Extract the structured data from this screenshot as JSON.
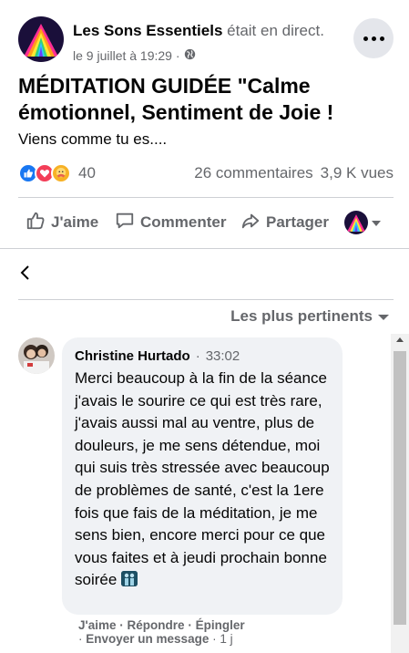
{
  "post": {
    "page_name": "Les Sons Essentiels",
    "live_text": "était en direct.",
    "date": "le 9 juillet à 19:29 ·",
    "audience_icon": "globe-icon",
    "title": "MÉDITATION GUIDÉE \"Calme émotionnel, Sentiment de Joie !",
    "text": "Viens comme tu es....",
    "reaction_count": "40",
    "comments_count": "26 commentaires",
    "views_count": "3,9 K vues"
  },
  "actions": {
    "like": "J'aime",
    "comment": "Commenter",
    "share": "Partager"
  },
  "comments_section": {
    "sort_label": "Les plus pertinents",
    "comment": {
      "author": "Christine Hurtado",
      "separator": "·",
      "time": "33:02",
      "text": "Merci beaucoup à la fin de la séance j'avais le sourire ce qui est très rare, j'avais aussi mal au ventre, plus de douleurs, je me sens détendue, moi qui suis très stressée avec beaucoup de problèmes de santé, c'est la 1ere fois que fais de la méditation, je me sens bien, encore merci pour ce que vous faites et à jeudi prochain bonne soirée",
      "like_label": "J'aime",
      "reply_label": "Répondre",
      "pin_label": "Épingler",
      "send_message_label": "Envoyer un message",
      "age": "1 j",
      "dot": "·"
    }
  },
  "colors": {
    "accent": "#1877f2",
    "secondary_text": "#65676b",
    "bubble": "#f0f2f5"
  }
}
